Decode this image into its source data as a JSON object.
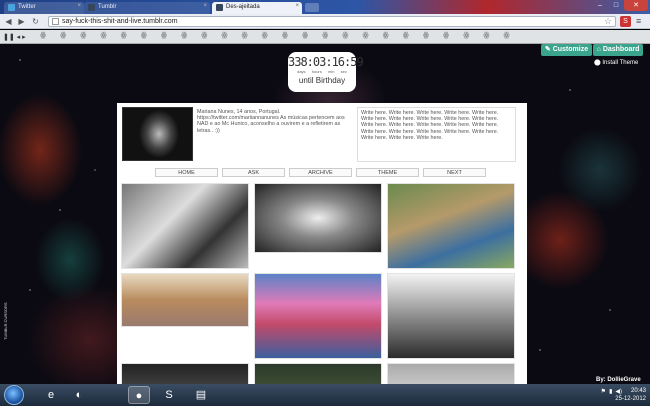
{
  "browser": {
    "tabs": [
      {
        "label": "Twitter",
        "color": "#4aa3df"
      },
      {
        "label": "Tumblr",
        "color": "#36465d"
      },
      {
        "label": "Des-ajeitada",
        "color": "#36465d"
      }
    ],
    "url": "say-fuck-this-shit-and-live.tumblr.com"
  },
  "theme": {
    "customize_label": "Customize",
    "dashboard_label": "Dashboard",
    "install_label": "Install Theme",
    "vertical_credit": "TUMBLR CURSORS"
  },
  "countdown": {
    "value": "338:03:16:59",
    "units": [
      "days",
      "hours",
      "min",
      "sec"
    ],
    "label": "until Birthday"
  },
  "profile": {
    "bio": "Mariana Nunes, 14 anos, Portugal. https://twitter.com/mariiannanunes As músicas pertencem aos NAD e ao Mc Hunico, aconselho a ouvirem e a refletirem as letras.. :))",
    "write_here": "Write here. Write here. Write here. Write here. Write here. Write here. Write here. Write here. Write here. Write here. Write here. Write here. Write here. Write here. Write here. Write here. Write here. Write here. Write here. Write here. Write here. Write here. Write here."
  },
  "nav": [
    "HOME",
    "ASK",
    "ARCHIVE",
    "THEME",
    "NEXT"
  ],
  "posts": [
    {
      "name": "post-converse-sneakers",
      "bg": "linear-gradient(135deg,#777,#ddd 40%,#333 70%,#bbb)"
    },
    {
      "name": "post-lips-braces",
      "bg": "radial-gradient(ellipse at 50% 50%,#eee,#888 40%,#222)"
    },
    {
      "name": "post-couple-hug",
      "bg": "linear-gradient(160deg,#6b8a4e,#b59a6a 40%,#3c6fa0 70%,#8aa860)"
    },
    {
      "name": "post-street-buildings",
      "bg": "linear-gradient(180deg,#e8d9c0,#b98b5e 50%,#9a7a6e)"
    },
    {
      "name": "post-castle-fireworks",
      "bg": "linear-gradient(180deg,#5b82c8,#e07bb8 35%,#c34a6a 60%,#3a5f9e)"
    },
    {
      "name": "post-couple-bench",
      "bg": "linear-gradient(180deg,#f3f3f3,#8f8f8f 50%,#2b2b2b)"
    },
    {
      "name": "post-row3-left",
      "bg": "linear-gradient(180deg,#222,#555)"
    },
    {
      "name": "post-row3-middle",
      "bg": "linear-gradient(180deg,#2b3a2b,#4b5b3b)"
    },
    {
      "name": "post-row3-right",
      "bg": "linear-gradient(180deg,#aaa,#ddd)"
    }
  ],
  "credit": "By: DollieGrave",
  "taskbar": {
    "apps": [
      "e",
      "◐",
      "●",
      "S",
      "▤"
    ],
    "time": "20:43",
    "date": "25-12-2012"
  }
}
